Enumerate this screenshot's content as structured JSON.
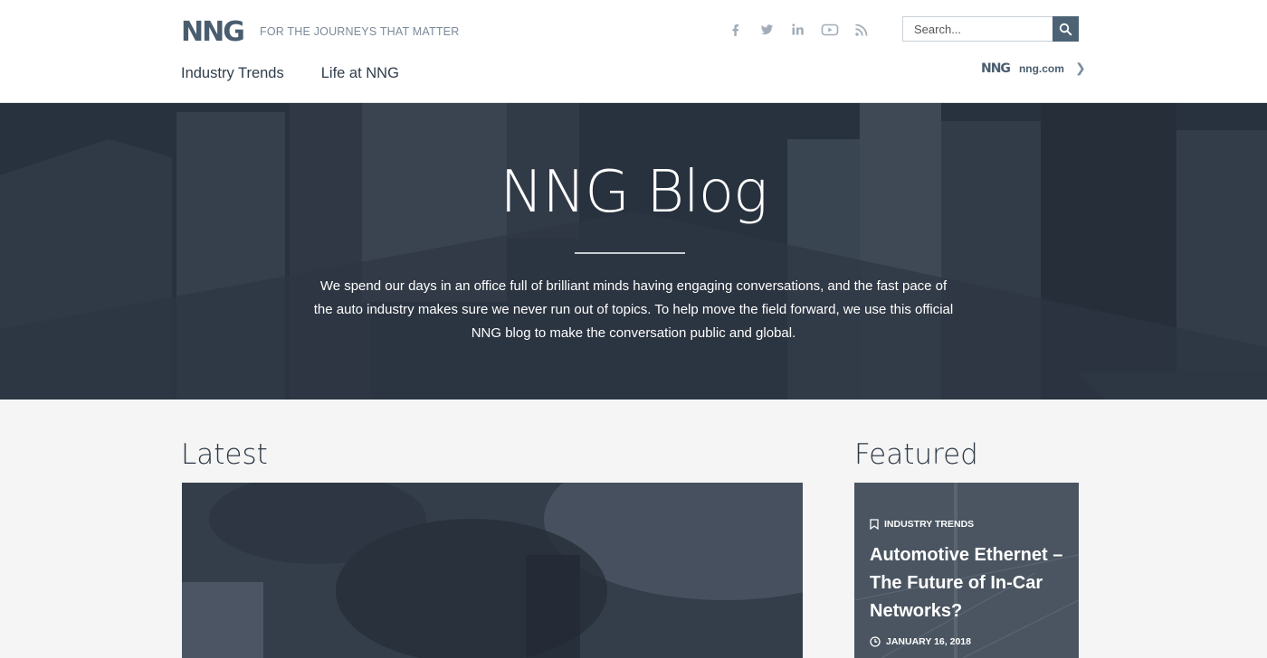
{
  "header": {
    "logo_text": "NNG",
    "tagline": "FOR THE JOURNEYS THAT MATTER",
    "social": [
      {
        "icon": "facebook-icon",
        "glyph": "f"
      },
      {
        "icon": "twitter-icon",
        "glyph": "🐦"
      },
      {
        "icon": "linkedin-icon",
        "glyph": "in"
      },
      {
        "icon": "youtube-icon",
        "glyph": "▶"
      },
      {
        "icon": "rss-icon",
        "glyph": "◝"
      }
    ],
    "search": {
      "placeholder": "Search..."
    },
    "nav": [
      "Industry Trends",
      "Life at NNG"
    ],
    "nng_link": {
      "logo_text": "NNG",
      "label": "nng.com",
      "arrow": "❯"
    }
  },
  "hero": {
    "title": "NNG Blog",
    "text": "We spend our days in an office full of brilliant minds having engaging conversations, and the fast pace of the auto industry makes sure we never run out of topics. To help move the field forward, we use this official NNG blog to make the conversation public and global."
  },
  "latest": {
    "title": "Latest"
  },
  "featured": {
    "title": "Featured",
    "card": {
      "category": "INDUSTRY TRENDS",
      "headline": "Automotive Ethernet – The Future of In-Car Networks?",
      "date": "JANUARY 16, 2018"
    }
  },
  "colors": {
    "brand": "#4a5d6f",
    "hero_bg": "#2d3643",
    "search_button": "#4d6275"
  }
}
